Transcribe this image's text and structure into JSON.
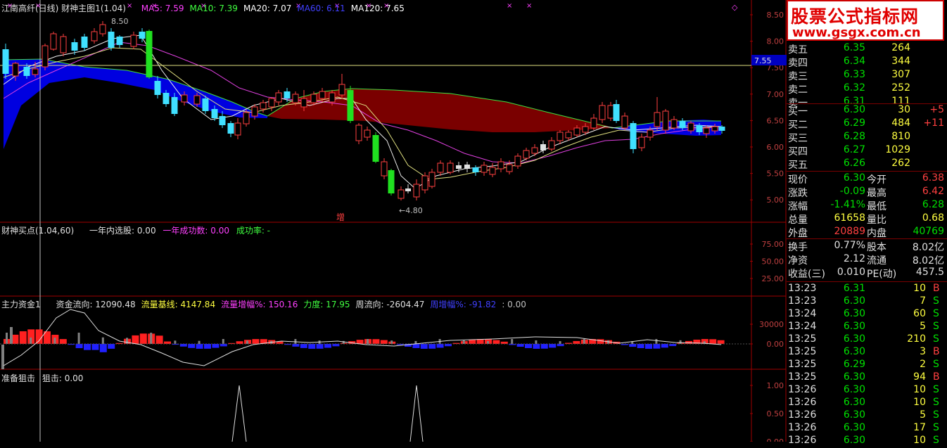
{
  "main_chart": {
    "title": "江南高纤(日线) 财神主图1(1.04)",
    "ma": [
      {
        "label": "MA5: 7.59",
        "color": "#ff40ff"
      },
      {
        "label": "MA10: 7.39",
        "color": "#40ff40"
      },
      {
        "label": "MA20: 7.07",
        "color": "#ffffff"
      },
      {
        "label": "MA60: 6.11",
        "color": "#4040ff"
      },
      {
        "label": "MA120: 7.65",
        "color": "#ffffff"
      }
    ],
    "y_ticks": [
      "8.50",
      "8.00",
      "7.50",
      "7.00",
      "6.50",
      "6.00",
      "5.50",
      "5.00"
    ],
    "high_label": "8.50",
    "low_label": "←4.80",
    "crosshair_price": "7.55",
    "signal_text": "增"
  },
  "panel2": {
    "title": "财神买点(1.04,60)",
    "stat1": "一年内选股: 0.00",
    "stat2": "一年成功数: 0.00",
    "stat3": "成功率: -",
    "y_ticks": [
      "75.00",
      "50.00",
      "25.00"
    ]
  },
  "panel3": {
    "title": "主力资金1",
    "items": [
      {
        "label": "资金流向: 12090.48",
        "color": "#e0e0e0"
      },
      {
        "label": "流量基线: 4147.84",
        "color": "#ffff40"
      },
      {
        "label": "流量增幅%: 150.16",
        "color": "#ff40ff"
      },
      {
        "label": "力度: 17.95",
        "color": "#40ff40"
      },
      {
        "label": "周流向: -2604.47",
        "color": "#e0e0e0"
      },
      {
        "label": "周增幅%: -91.82",
        "color": "#4040ff"
      },
      {
        "label": ": 0.00",
        "color": "#c0c0c0"
      }
    ],
    "y_ticks": [
      "30000",
      "0.00"
    ]
  },
  "panel4": {
    "title": "准备狙击",
    "value": "狙击: 0.00",
    "y_ticks": [
      "1.00",
      "0.50",
      "0.00"
    ]
  },
  "banner": {
    "line1": "股票公式指标网",
    "line2": "www.gsgx.com.cn"
  },
  "order_book": {
    "asks": [
      {
        "label": "卖五",
        "price": "6.35",
        "vol": "264"
      },
      {
        "label": "卖四",
        "price": "6.34",
        "vol": "344"
      },
      {
        "label": "卖三",
        "price": "6.33",
        "vol": "307"
      },
      {
        "label": "卖二",
        "price": "6.32",
        "vol": "252"
      },
      {
        "label": "卖一",
        "price": "6.31",
        "vol": "111"
      }
    ],
    "bids": [
      {
        "label": "买一",
        "price": "6.30",
        "vol": "30",
        "chg": "+5"
      },
      {
        "label": "买二",
        "price": "6.29",
        "vol": "484",
        "chg": "+11"
      },
      {
        "label": "买三",
        "price": "6.28",
        "vol": "810",
        "chg": ""
      },
      {
        "label": "买四",
        "price": "6.27",
        "vol": "1029",
        "chg": ""
      },
      {
        "label": "买五",
        "price": "6.26",
        "vol": "262",
        "chg": ""
      }
    ]
  },
  "quote": [
    {
      "l1": "现价",
      "v1": "6.30",
      "c1": "g",
      "l2": "今开",
      "v2": "6.38",
      "c2": "r"
    },
    {
      "l1": "涨跌",
      "v1": "-0.09",
      "c1": "g",
      "l2": "最高",
      "v2": "6.42",
      "c2": "r"
    },
    {
      "l1": "涨幅",
      "v1": "-1.41%",
      "c1": "g",
      "l2": "最低",
      "v2": "6.28",
      "c2": "g"
    },
    {
      "l1": "总量",
      "v1": "61658",
      "c1": "y",
      "l2": "量比",
      "v2": "0.68",
      "c2": "y"
    },
    {
      "l1": "外盘",
      "v1": "20889",
      "c1": "r",
      "l2": "内盘",
      "v2": "40769",
      "c2": "g"
    }
  ],
  "fundamentals": [
    {
      "l1": "换手",
      "v1": "0.77%",
      "l2": "股本",
      "v2": "8.02亿"
    },
    {
      "l1": "净资",
      "v1": "2.12",
      "l2": "流通",
      "v2": "8.02亿"
    },
    {
      "l1": "收益(三)",
      "v1": "0.010",
      "l2": "PE(动)",
      "v2": "457.5"
    }
  ],
  "ticks": [
    {
      "time": "13:23",
      "price": "6.31",
      "vol": "10",
      "side": "B"
    },
    {
      "time": "13:23",
      "price": "6.30",
      "vol": "7",
      "side": "S"
    },
    {
      "time": "13:24",
      "price": "6.30",
      "vol": "60",
      "side": "S"
    },
    {
      "time": "13:24",
      "price": "6.30",
      "vol": "5",
      "side": "S"
    },
    {
      "time": "13:25",
      "price": "6.30",
      "vol": "210",
      "side": "S"
    },
    {
      "time": "13:25",
      "price": "6.30",
      "vol": "3",
      "side": "B"
    },
    {
      "time": "13:25",
      "price": "6.29",
      "vol": "2",
      "side": "S"
    },
    {
      "time": "13:25",
      "price": "6.30",
      "vol": "94",
      "side": "B"
    },
    {
      "time": "13:26",
      "price": "6.30",
      "vol": "10",
      "side": "S"
    },
    {
      "time": "13:26",
      "price": "6.30",
      "vol": "10",
      "side": "S"
    },
    {
      "time": "13:26",
      "price": "6.30",
      "vol": "5",
      "side": "S"
    },
    {
      "time": "13:26",
      "price": "6.30",
      "vol": "17",
      "side": "S"
    },
    {
      "time": "13:26",
      "price": "6.30",
      "vol": "10",
      "side": "S"
    }
  ]
}
